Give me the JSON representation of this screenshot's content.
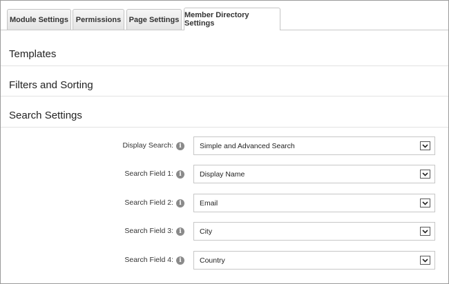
{
  "tabs": [
    {
      "label": "Module Settings",
      "active": false
    },
    {
      "label": "Permissions",
      "active": false
    },
    {
      "label": "Page Settings",
      "active": false
    },
    {
      "label": "Member Directory Settings",
      "active": true
    }
  ],
  "sections": {
    "templates": "Templates",
    "filters_sorting": "Filters and Sorting",
    "search_settings": "Search Settings"
  },
  "search_fields": [
    {
      "label": "Display Search:",
      "value": "Simple and Advanced Search"
    },
    {
      "label": "Search Field 1:",
      "value": "Display Name"
    },
    {
      "label": "Search Field 2:",
      "value": "Email"
    },
    {
      "label": "Search Field 3:",
      "value": "City"
    },
    {
      "label": "Search Field 4:",
      "value": "Country"
    }
  ],
  "icons": {
    "info": "info-icon",
    "dropdown": "chevron-down-icon"
  }
}
